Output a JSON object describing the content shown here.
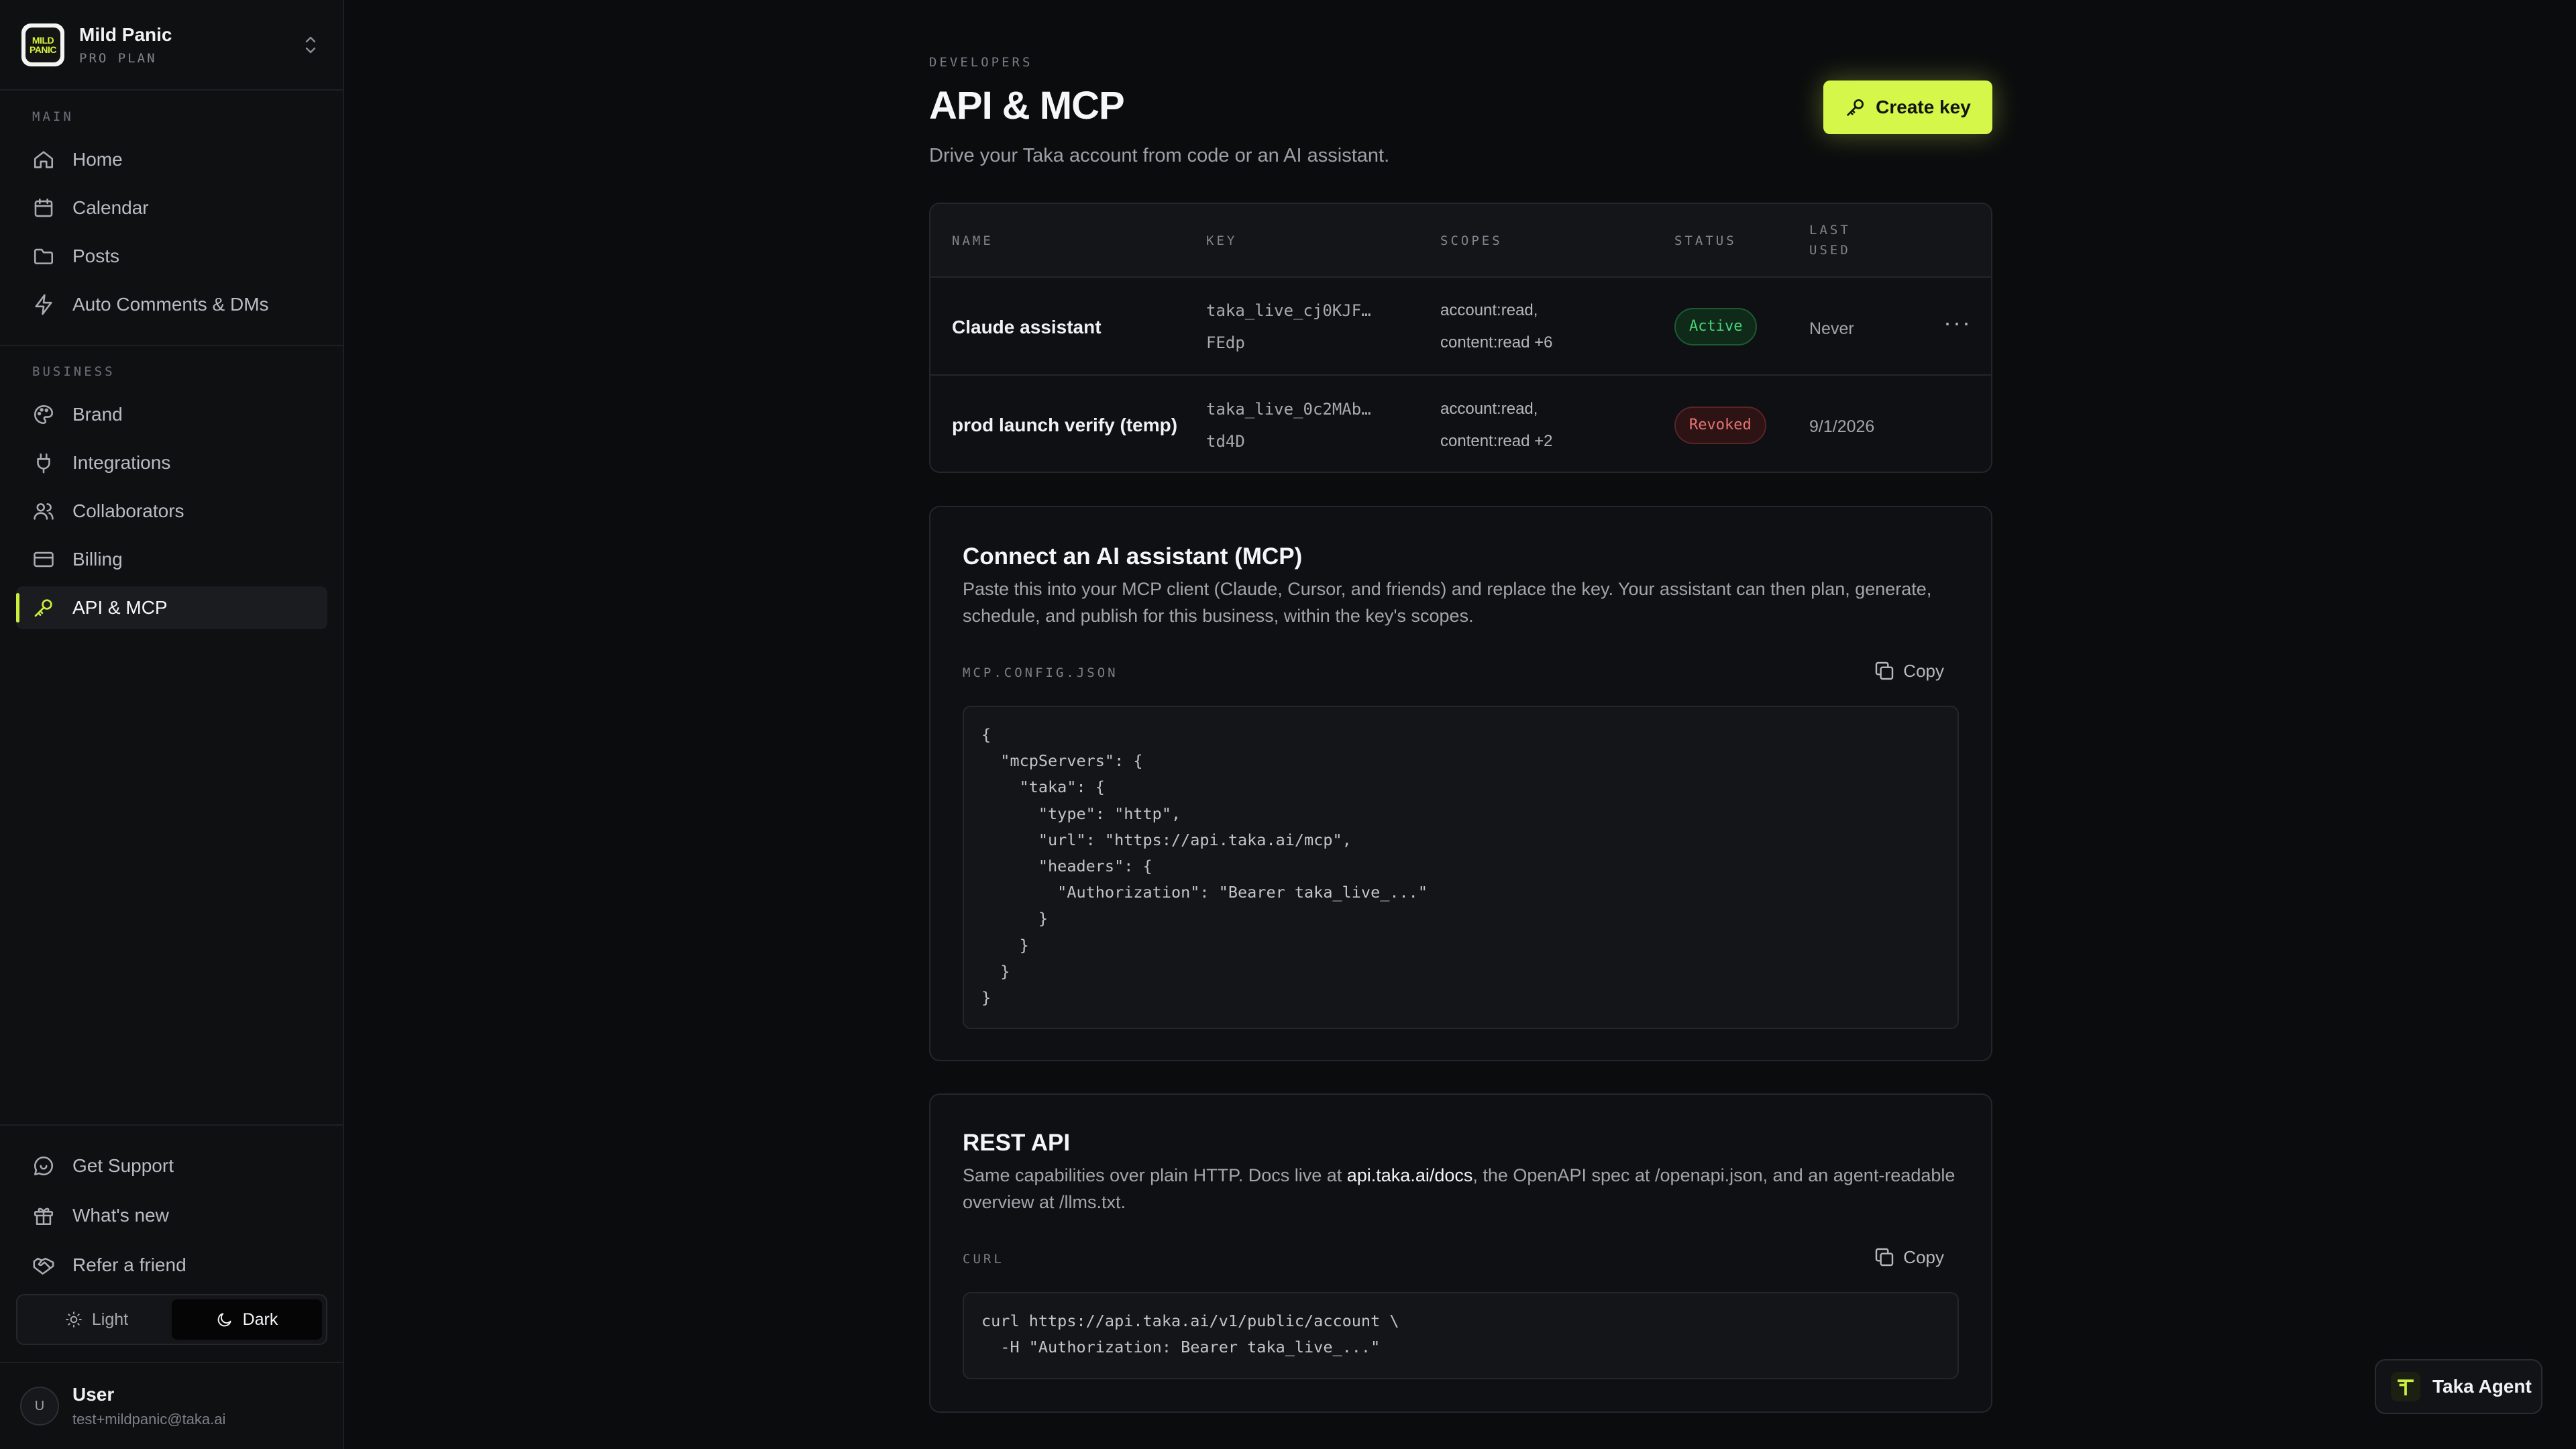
{
  "workspace": {
    "name": "Mild Panic",
    "plan": "PRO PLAN",
    "logo_text": [
      "MILD",
      "PANIC"
    ]
  },
  "sidebar": {
    "main_label": "MAIN",
    "main_items": [
      {
        "label": "Home",
        "icon": "home-icon"
      },
      {
        "label": "Calendar",
        "icon": "calendar-icon"
      },
      {
        "label": "Posts",
        "icon": "folder-icon"
      },
      {
        "label": "Auto Comments & DMs",
        "icon": "lightning-icon"
      }
    ],
    "business_label": "BUSINESS",
    "business_items": [
      {
        "label": "Brand",
        "icon": "palette-icon"
      },
      {
        "label": "Integrations",
        "icon": "plug-icon"
      },
      {
        "label": "Collaborators",
        "icon": "users-icon"
      },
      {
        "label": "Billing",
        "icon": "credit-card-icon"
      },
      {
        "label": "API & MCP",
        "icon": "key-icon",
        "active": true
      }
    ],
    "footer_items": [
      {
        "label": "Get Support",
        "icon": "chat-icon"
      },
      {
        "label": "What's new",
        "icon": "gift-icon"
      },
      {
        "label": "Refer a friend",
        "icon": "handshake-icon"
      }
    ],
    "theme": {
      "light_label": "Light",
      "dark_label": "Dark",
      "selected": "Dark"
    },
    "user": {
      "initial": "U",
      "name": "User",
      "email": "test+mildpanic@taka.ai"
    }
  },
  "header": {
    "eyebrow": "DEVELOPERS",
    "title": "API & MCP",
    "subtitle": "Drive your Taka account from code or an AI assistant.",
    "create_button": "Create key"
  },
  "keys_table": {
    "columns": [
      "NAME",
      "KEY",
      "SCOPES",
      "STATUS",
      "LAST",
      "USED"
    ],
    "rows": [
      {
        "name": "Claude assistant",
        "key_line1": "taka_live_cj0KJF…",
        "key_line2": "FEdp",
        "scope_line1": "account:read,",
        "scope_line2": "content:read +6",
        "status": "Active",
        "last_used": "Never",
        "menu": "···"
      },
      {
        "name": "prod launch verify (temp)",
        "key_line1": "taka_live_0c2MAb…",
        "key_line2": "td4D",
        "scope_line1": "account:read,",
        "scope_line2": "content:read +2",
        "status": "Revoked",
        "last_used": "9/1/2026"
      }
    ]
  },
  "mcp_card": {
    "title": "Connect an AI assistant (MCP)",
    "description": "Paste this into your MCP client (Claude, Cursor, and friends) and replace the key. Your assistant can then plan, generate, schedule, and publish for this business, within the key's scopes.",
    "code_label": "MCP.CONFIG.JSON",
    "copy_label": "Copy",
    "code": "{\n  \"mcpServers\": {\n    \"taka\": {\n      \"type\": \"http\",\n      \"url\": \"https://api.taka.ai/mcp\",\n      \"headers\": {\n        \"Authorization\": \"Bearer taka_live_...\"\n      }\n    }\n  }\n}"
  },
  "rest_card": {
    "title": "REST API",
    "desc_before": "Same capabilities over plain HTTP. Docs live at ",
    "desc_link": "api.taka.ai/docs",
    "desc_after": ", the OpenAPI spec at /openapi.json, and an agent-readable overview at /llms.txt.",
    "code_label": "CURL",
    "copy_label": "Copy",
    "code": "curl https://api.taka.ai/v1/public/account \\\n  -H \"Authorization: Bearer taka_live_...\""
  },
  "agent_button": {
    "label": "Taka Agent"
  },
  "colors": {
    "accent": "#d4f74a",
    "active_status": "#4ad37a",
    "revoked_status": "#e57373",
    "background": "#0b0c0e"
  }
}
